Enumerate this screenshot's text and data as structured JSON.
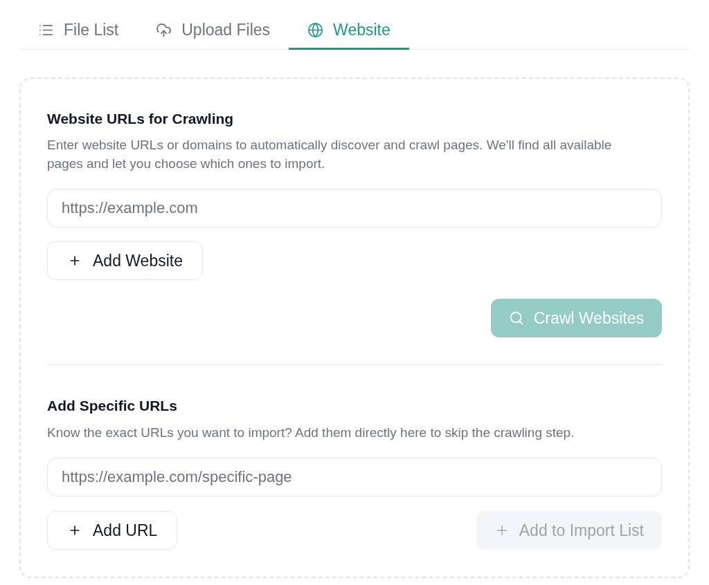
{
  "tabs": [
    {
      "label": "File List",
      "selected": false
    },
    {
      "label": "Upload Files",
      "selected": false
    },
    {
      "label": "Website",
      "selected": true
    }
  ],
  "sections": [
    {
      "kind": "crawl",
      "title": "Website URLs for Crawling",
      "description": "Enter website URLs or domains to automatically discover and crawl pages. We'll find all available pages and let you choose which ones to import.",
      "input": {
        "placeholder": "https://example.com"
      },
      "add_button": {
        "label": "Add Website"
      },
      "submit_button": {
        "label": "Crawl Websites",
        "disabled": true
      }
    },
    {
      "kind": "specific",
      "title": "Add Specific URLs",
      "description": "Know the exact URLs you want to import? Add them directly here to skip the crawling step.",
      "input": {
        "placeholder": "https://example.com/specific-page"
      },
      "add_button": {
        "label": "Add URL"
      },
      "submit_button": {
        "label": "Add to Import List",
        "disabled": true
      }
    }
  ]
}
